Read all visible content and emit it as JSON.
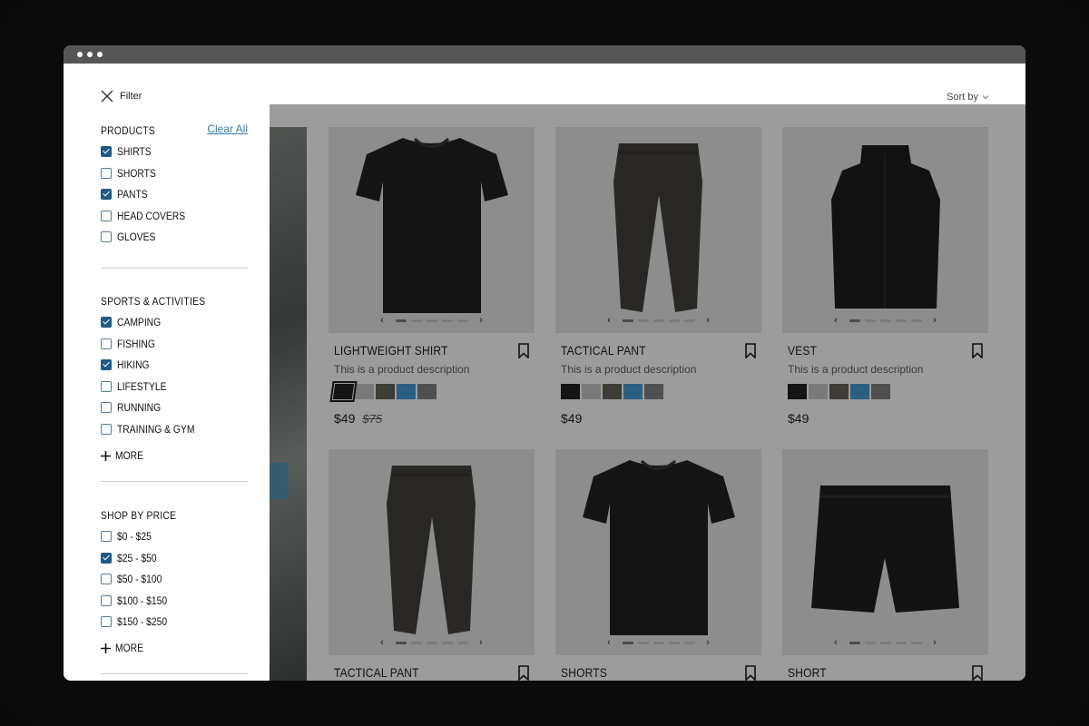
{
  "filter": {
    "title": "Filter",
    "clear_all": "Clear All",
    "more_label": "MORE",
    "sections": {
      "products": {
        "title": "PRODUCTS",
        "options": [
          {
            "label": "SHIRTS",
            "checked": true
          },
          {
            "label": "SHORTS",
            "checked": false
          },
          {
            "label": "PANTS",
            "checked": true
          },
          {
            "label": "HEAD COVERS",
            "checked": false
          },
          {
            "label": "GLOVES",
            "checked": false
          }
        ]
      },
      "sports": {
        "title": "SPORTS & ACTIVITIES",
        "options": [
          {
            "label": "CAMPING",
            "checked": true
          },
          {
            "label": "FISHING",
            "checked": false
          },
          {
            "label": "HIKING",
            "checked": true
          },
          {
            "label": "LIFESTYLE",
            "checked": false
          },
          {
            "label": "RUNNING",
            "checked": false
          },
          {
            "label": "TRAINING & GYM",
            "checked": false
          }
        ]
      },
      "price": {
        "title": "SHOP BY PRICE",
        "options": [
          {
            "label": "$0 - $25",
            "checked": false
          },
          {
            "label": "$25 - $50",
            "checked": true
          },
          {
            "label": "$50 - $100",
            "checked": false
          },
          {
            "label": "$100 - $150",
            "checked": false
          },
          {
            "label": "$150 - $250",
            "checked": false
          }
        ]
      }
    }
  },
  "sort": {
    "label": "Sort by"
  },
  "swatch_colors": [
    "#161616",
    "#c4c4c4",
    "#5e5a52",
    "#3e95d1",
    "#7b7b7b"
  ],
  "products": [
    {
      "name": "LIGHTWEIGHT SHIRT",
      "description": "This is a product description",
      "price": "$49",
      "old_price": "$75",
      "selected_swatch": 0
    },
    {
      "name": "TACTICAL PANT",
      "description": "This is a product description",
      "price": "$49",
      "selected_swatch": -1
    },
    {
      "name": "VEST",
      "description": "This is a product description",
      "price": "$49",
      "selected_swatch": -1
    },
    {
      "name": "TACTICAL PANT"
    },
    {
      "name": "SHORTS"
    },
    {
      "name": "SHORT"
    }
  ],
  "icons": {
    "close": "close-icon",
    "chevron": "chevron-down-icon",
    "bookmark": "bookmark-icon",
    "plus": "plus-icon",
    "arrow_left": "‹",
    "arrow_right": "›"
  }
}
